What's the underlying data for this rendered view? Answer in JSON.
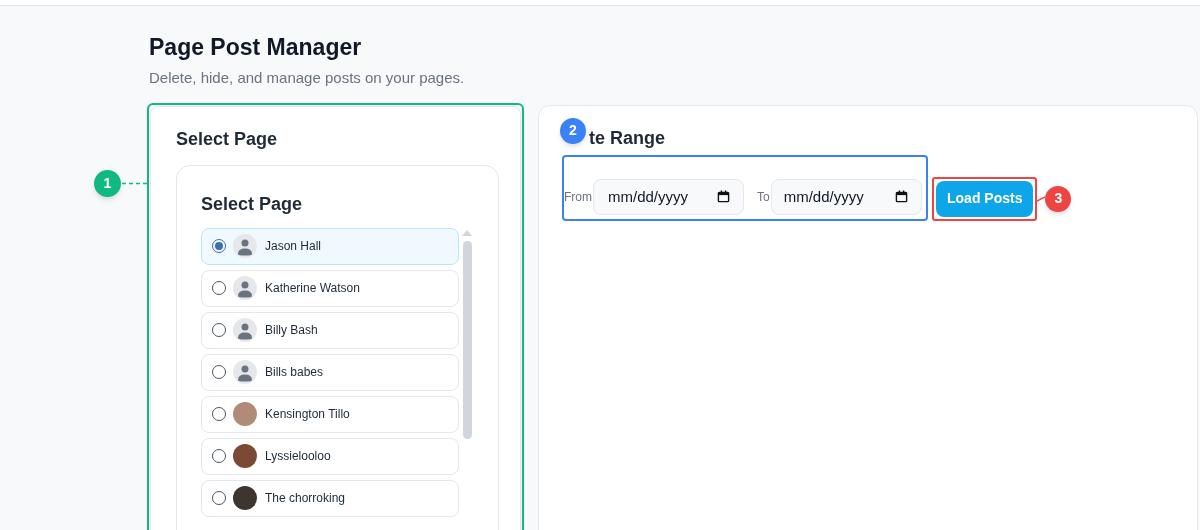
{
  "header": {
    "title": "Page Post Manager",
    "subtitle": "Delete, hide, and manage posts on your pages."
  },
  "select_panel": {
    "title": "Select Page",
    "list_title": "Select Page",
    "pages": [
      {
        "name": "Jason Hall",
        "selected": true,
        "kind": "default"
      },
      {
        "name": "Katherine Watson",
        "selected": false,
        "kind": "default"
      },
      {
        "name": "Billy Bash",
        "selected": false,
        "kind": "default"
      },
      {
        "name": "Bills babes",
        "selected": false,
        "kind": "default"
      },
      {
        "name": "Kensington Tillo",
        "selected": false,
        "kind": "photo"
      },
      {
        "name": "Lyssielooloo",
        "selected": false,
        "kind": "photo"
      },
      {
        "name": "The chorroking",
        "selected": false,
        "kind": "photo"
      }
    ]
  },
  "date_panel": {
    "title": "te Range",
    "from_label": "From",
    "from_placeholder": "mm/dd/yyyy",
    "to_label": "To",
    "to_placeholder": "mm/dd/yyyy",
    "button": "Load Posts"
  },
  "annotations": [
    {
      "label": "1",
      "color": "#10b981"
    },
    {
      "label": "2",
      "color": "#3b82f6"
    },
    {
      "label": "3",
      "color": "#ef4444"
    }
  ]
}
